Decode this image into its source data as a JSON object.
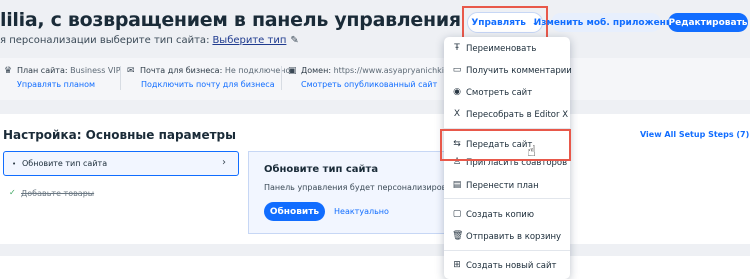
{
  "header": {
    "title": "lilia, с возвращением в панель управления",
    "subtitle": "я персонализации выберите тип сайта:",
    "subtitle_link": "Выберите тип",
    "manage_label": "Управлять",
    "mobile_label": "Изменить моб. приложение",
    "edit_label": "Редактировать"
  },
  "info": {
    "plan_label": "План сайта:",
    "plan_value": "Business VIP",
    "plan_link": "Управлять планом",
    "mail_label": "Почта для бизнеса:",
    "mail_value": "Не подключено",
    "mail_link": "Подключить почту для бизнеса",
    "domain_label": "Домен:",
    "domain_value": "https://www.asyapryanichki.com/",
    "domain_link": "Смотреть опубликованный сайт"
  },
  "setup": {
    "title": "Настройка: Основные параметры",
    "view_all": "View All Setup Steps (7)",
    "step1": "Обновите тип сайта",
    "step2": "Добавьте товары",
    "card_title": "Обновите тип сайта",
    "card_desc": "Панель управления будет персонализирова",
    "update_btn": "Обновить",
    "not_relevant": "Неактуально"
  },
  "menu": {
    "rename": "Переименовать",
    "comments": "Получить комментарии",
    "view_site": "Смотреть сайт",
    "rebuild": "Пересобрать в Editor X",
    "transfer": "Передать сайт",
    "invite": "Пригласить соавторов",
    "move_plan": "Перенести план",
    "duplicate": "Создать копию",
    "trash": "Отправить в корзину",
    "new_site": "Создать новый сайт"
  }
}
